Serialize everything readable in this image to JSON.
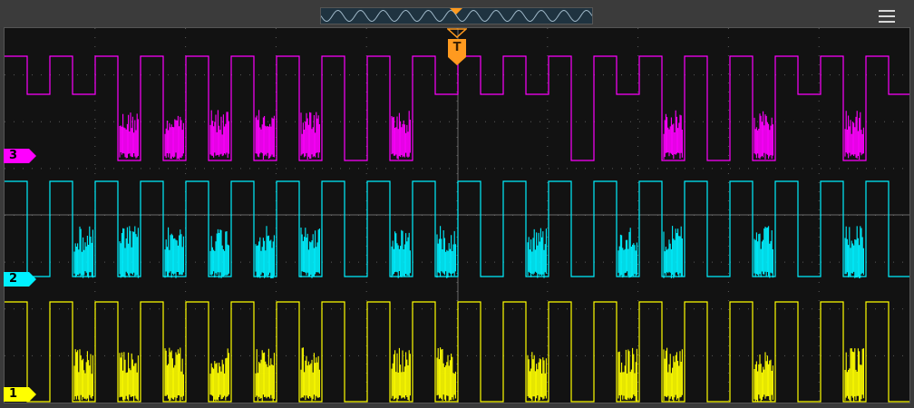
{
  "window": {
    "title": ""
  },
  "toolbar": {
    "menu_icon": "hamburger-menu-icon",
    "overview_icon": "waveform-overview-icon"
  },
  "colors": {
    "background": "#121212",
    "grid": "#5a5a5a",
    "ch1": "#ffff00",
    "ch2": "#00f0ff",
    "ch3": "#ff00ff",
    "trigger": "#ff9a1f",
    "overview_wave": "#9fb8c8"
  },
  "trigger": {
    "label": "T",
    "icon": "trigger-position-icon"
  },
  "channels": [
    {
      "id": "ch3",
      "label": "3",
      "color": "#ff00ff"
    },
    {
      "id": "ch2",
      "label": "2",
      "color": "#00f0ff"
    },
    {
      "id": "ch1",
      "label": "1",
      "color": "#ffff00"
    }
  ],
  "pattern": {
    "highs_per_screen": 20,
    "ch3_shallow_low": [
      0,
      1,
      9,
      10,
      11,
      13,
      17,
      19
    ],
    "noisy_low": [
      1,
      2,
      3,
      4,
      5,
      6,
      8,
      9,
      11,
      13,
      14,
      16,
      18
    ]
  }
}
